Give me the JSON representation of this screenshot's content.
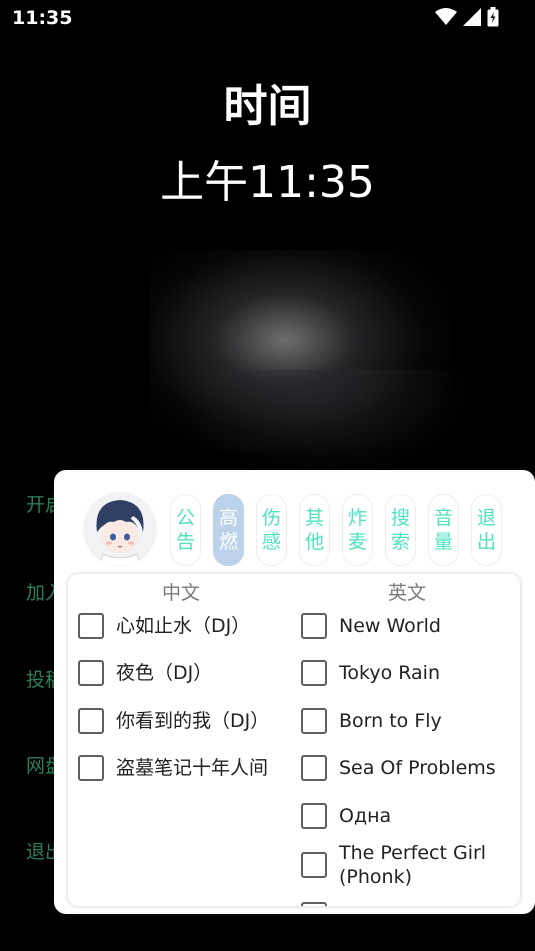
{
  "status": {
    "time": "11:35"
  },
  "clock": {
    "label": "时间",
    "time": "上午11:35"
  },
  "side_menu": [
    "开启",
    "加入",
    "投稿",
    "网盘",
    "退出"
  ],
  "tabs": [
    {
      "label": "公告",
      "active": false
    },
    {
      "label": "高燃",
      "active": true
    },
    {
      "label": "伤感",
      "active": false
    },
    {
      "label": "其他",
      "active": false
    },
    {
      "label": "炸麦",
      "active": false
    },
    {
      "label": "搜索",
      "active": false
    },
    {
      "label": "音量",
      "active": false
    },
    {
      "label": "退出",
      "active": false
    }
  ],
  "lists": {
    "chinese": {
      "header": "中文",
      "items": [
        "心如止水（DJ）",
        "夜色（DJ）",
        "你看到的我（DJ）",
        "盗墓笔记十年人间"
      ]
    },
    "english": {
      "header": "英文",
      "items": [
        "New World",
        "Tokyo Rain",
        "Born to Fly",
        "Sea Of Problems",
        "Одна",
        "The Perfect Girl (Phonk)"
      ]
    }
  },
  "colors": {
    "tab_text": "#4fe3c0",
    "tab_active_bg": "#bcd2ea",
    "side_menu_text": "#2e7d5a"
  }
}
